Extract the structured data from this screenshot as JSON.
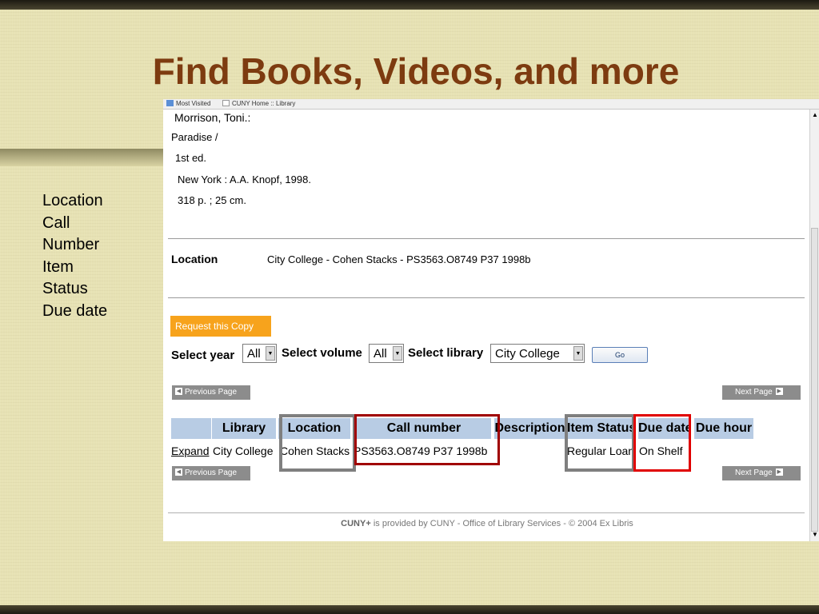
{
  "slide": {
    "title": "Find Books, Videos, and more",
    "side_lines": [
      "Location",
      "Call",
      "Number",
      "Item",
      "Status",
      "Due date"
    ]
  },
  "browser": {
    "bookmarks": [
      "Most Visited",
      "CUNY Home :: Library"
    ]
  },
  "record": {
    "author": "Morrison, Toni.:",
    "title": "Paradise /",
    "edition": "1st ed.",
    "publisher": "New York : A.A. Knopf, 1998.",
    "extent": "318 p. ; 25 cm.",
    "location_label": "Location",
    "location_value": "City College - Cohen Stacks - PS3563.O8749 P37 1998b"
  },
  "controls": {
    "request_button": "Request this Copy",
    "select_year_label": "Select year",
    "select_year_value": "All",
    "select_volume_label": "Select volume",
    "select_volume_value": "All",
    "select_library_label": "Select library",
    "select_library_value": "City College",
    "go_button": "Go",
    "previous_page": "Previous Page",
    "next_page": "Next Page"
  },
  "holdings": {
    "headers": [
      "Library",
      "Location",
      "Call number",
      "Description",
      "Item Status",
      "Due date",
      "Due hour"
    ],
    "row": {
      "expand": "Expand",
      "library": "City College",
      "location": "Cohen Stacks",
      "call_number": "PS3563.O8749 P37 1998b",
      "description": "",
      "item_status": "Regular Loan",
      "due_date": "On Shelf",
      "due_hour": ""
    }
  },
  "footer": {
    "brand": "CUNY+",
    "text": " is provided by CUNY - Office of Library Services - © 2004 Ex Libris"
  },
  "colors": {
    "title": "#7d3b10",
    "request_button": "#f7a31c",
    "table_header": "#b8cce4",
    "highlight_gray": "#7f7f7f",
    "highlight_darkred": "#a00000",
    "highlight_red": "#e00000"
  }
}
